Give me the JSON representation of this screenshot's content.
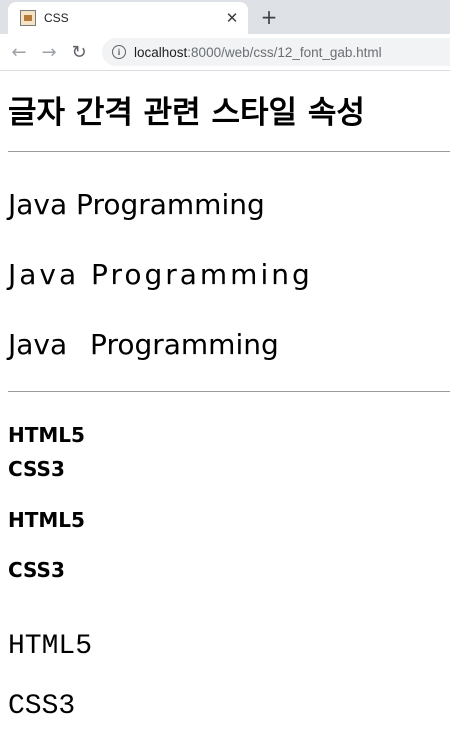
{
  "browser": {
    "tab_title": "CSS",
    "tab_close": "✕",
    "new_tab": "+",
    "url_host": "localhost",
    "url_path": ":8000/web/css/12_font_gab.html",
    "back": "←",
    "forward": "→",
    "reload": "↻",
    "info": "i"
  },
  "page": {
    "heading": "글자 간격 관련 스타일 속성",
    "java_lines": [
      "Java Programming",
      "Java Programming",
      "Java Programming"
    ],
    "html5": "HTML5",
    "css3": "CSS3"
  }
}
